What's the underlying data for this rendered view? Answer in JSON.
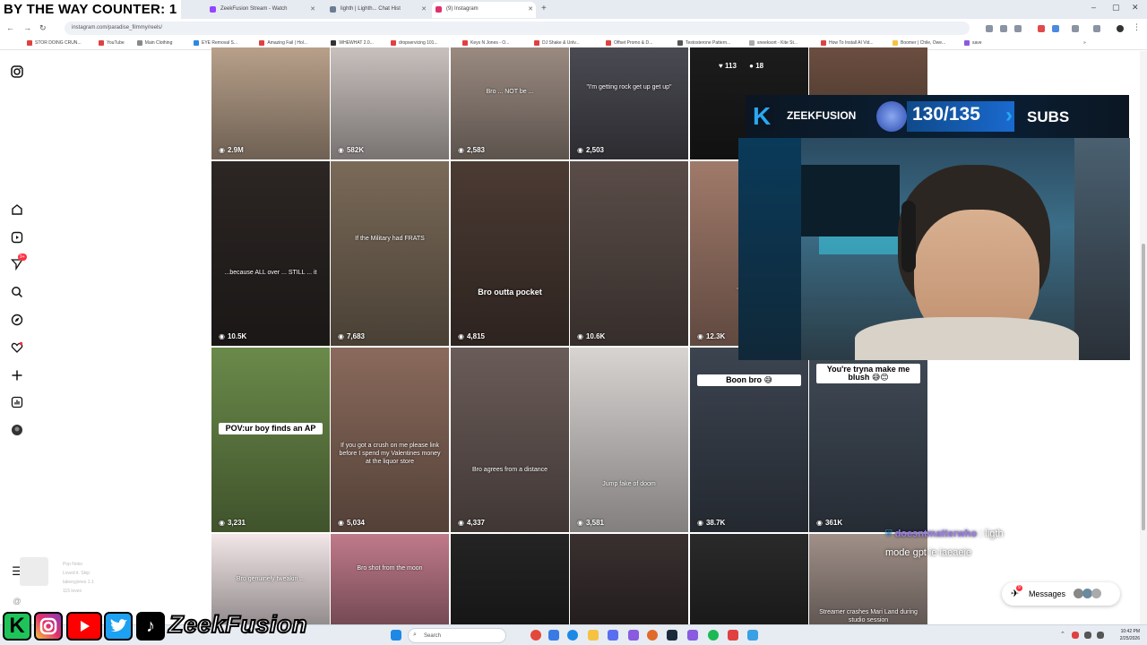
{
  "overlay": {
    "counter": "BY THE WAY COUNTER: 1"
  },
  "tabs": [
    {
      "label": "ZeekFusion Stream - Watch",
      "color": "#9146ff"
    },
    {
      "label": "lighth | Lighth... Chat Hist",
      "color": "#6b7c93"
    },
    {
      "label": "(9) Instagram",
      "color": "#e1306c"
    }
  ],
  "toolbar": {
    "url": "instagram.com/paradise_filmmy/reels/"
  },
  "bookmarks": [
    "STOR DOING CRUN...",
    "YouTube",
    "Main Clothing",
    "EYE Removal S...",
    "Amazing Fail | Hol...",
    "WHEWHAT 2.0...",
    "dropservicing 101...",
    "Keys N Jones - O...",
    "DJ Shake & Unlv...",
    "Offset Promo & D...",
    "Testosterone Pattern...",
    "sneeksort - Kite St...",
    "How To Install AI Vid...",
    "Boomer | Chile, Owe...",
    "save"
  ],
  "grid": [
    {
      "views": "2.9M",
      "bg": "#b8a08a",
      "caption": ""
    },
    {
      "views": "582K",
      "bg": "#c8c0bd",
      "caption": ""
    },
    {
      "views": "2,583",
      "bg": "#9a8a80",
      "caption": "Bro ... NOT be ... "
    },
    {
      "views": "2,503",
      "bg": "#4a4a52",
      "caption": "\"I'm getting rock get up get up\""
    },
    {
      "views": "",
      "bg": "#1c1c1c",
      "caption": ""
    },
    {
      "views": "",
      "bg": "#6b4e40",
      "caption": ""
    },
    {
      "views": "10.5K",
      "bg": "#2c2624",
      "caption": "...because ALL over ... STILL ... it"
    },
    {
      "views": "7,683",
      "bg": "#7a6a58",
      "caption": "If the Military had FRATS"
    },
    {
      "views": "4,815",
      "bg": "#4b3b33",
      "caption": "Bro outta pocket"
    },
    {
      "views": "10.6K",
      "bg": "#5a4d48",
      "caption": ""
    },
    {
      "views": "12.3K",
      "bg": "#a07a6a",
      "caption": "\"I was...\""
    },
    {
      "views": "3,231",
      "bg": "#6a8a4a",
      "caption": "POV:ur boy finds an AP"
    },
    {
      "views": "5,034",
      "bg": "#8a6a5c",
      "caption": "If you got a crush on me please link before I spend my Valentines money at the liquor store"
    },
    {
      "views": "4,337",
      "bg": "#6a5c58",
      "caption": "Bro agrees from a distance"
    },
    {
      "views": "3,581",
      "bg": "#d8d4d2",
      "caption": "Jump fake of doom"
    },
    {
      "views": "38.7K",
      "bg": "#3c4450",
      "caption": "Boon bro 😅"
    },
    {
      "views": "361K",
      "bg": "#404a56",
      "caption": "You're tryna make me blush 😅😊"
    },
    {
      "views": "",
      "bg": "#f2e6e8",
      "caption": "Bro genuinely tweakin ..."
    },
    {
      "views": "",
      "bg": "#c07a8a",
      "caption": "Bro shot from the moon"
    },
    {
      "views": "",
      "bg": "#242424",
      "caption": ""
    },
    {
      "views": "",
      "bg": "#3a3030",
      "caption": ""
    },
    {
      "views": "",
      "bg": "#2a2a2a",
      "caption": ""
    },
    {
      "views": "",
      "bg": "#a09088",
      "caption": "Streamer crashes Mari Land during studio session"
    }
  ],
  "top_stats": {
    "likes": "113",
    "comments": "18"
  },
  "subs": {
    "brand": "ZEEKFUSION",
    "count": "130/135",
    "label": "SUBS"
  },
  "chat": {
    "user": "doesntmatterwho",
    "colon": " : ",
    "text_1": "ligth",
    "text_2": "mode gpt ie iaeaeie"
  },
  "messages": {
    "label": "Messages",
    "badge": "9"
  },
  "taskbar": {
    "search": "Search",
    "time": "10:42 PM",
    "date": "2/25/2026"
  },
  "sidebar_profile": {
    "line1": "Pop Noko",
    "line2": "Loved it. Skip",
    "line3": "lakeeyjones 1.1",
    "line4": "115 loves"
  },
  "brand_bar": {
    "name": "ZeekFusion"
  },
  "notification_badge": "9+"
}
